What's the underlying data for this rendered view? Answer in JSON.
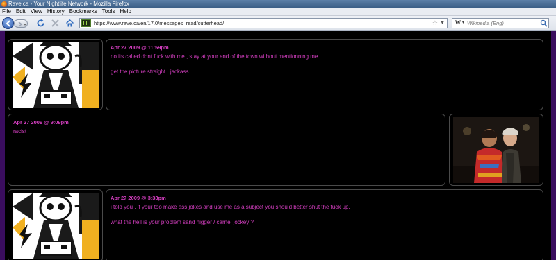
{
  "window": {
    "title": "Rave.ca - Your Nightlife Network - Mozilla Firefox"
  },
  "menu": [
    "File",
    "Edit",
    "View",
    "History",
    "Bookmarks",
    "Tools",
    "Help"
  ],
  "nav": {
    "url": "https://www.rave.ca/en/17.0/messages_read/cutterhead/",
    "search_placeholder": "Wikipedia (Eng)",
    "search_engine_letter": "W"
  },
  "messages": [
    {
      "date": "Apr 27 2009 @ 11:59pm",
      "lines": [
        "no its called dont fuck with me , stay at your end of the town without mentionning me.",
        "get the picture straight . jackass"
      ]
    },
    {
      "date": "Apr 27 2009 @ 9:09pm",
      "lines": [
        "racist"
      ]
    },
    {
      "date": "Apr 27 2009 @ 3:33pm",
      "lines": [
        "i told you , if your too make ass jokes and use me as a subject you should better shut the fuck up.",
        "what the hell is your problem sand nigger / carnel jockey ?"
      ]
    }
  ],
  "colors": {
    "accent": "#d63fc2",
    "background": "#000000",
    "border": "#4a4a4a"
  }
}
